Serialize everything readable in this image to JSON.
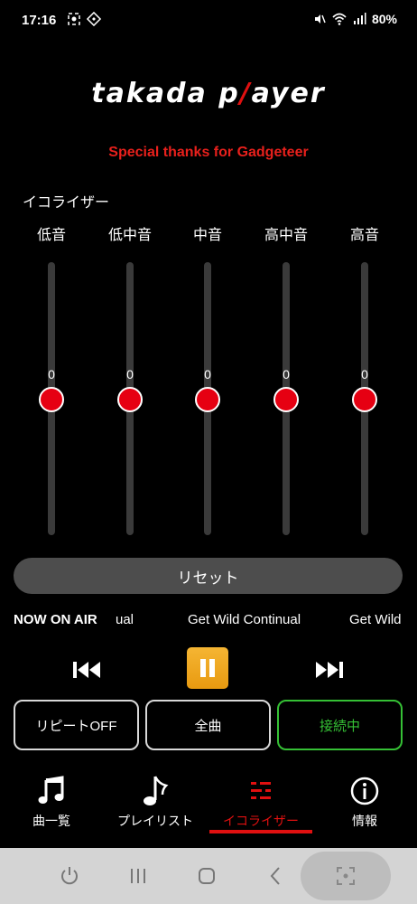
{
  "status": {
    "time": "17:16",
    "battery": "80%"
  },
  "app": {
    "logo_main": "takada p",
    "logo_accent": "/",
    "logo_end": "ayer",
    "thanks": "Special thanks for Gadgeteer"
  },
  "equalizer": {
    "title": "イコライザー",
    "bands": [
      {
        "label": "低音",
        "value": "0"
      },
      {
        "label": "低中音",
        "value": "0"
      },
      {
        "label": "中音",
        "value": "0"
      },
      {
        "label": "高中音",
        "value": "0"
      },
      {
        "label": "高音",
        "value": "0"
      }
    ],
    "reset_label": "リセット"
  },
  "now_playing": {
    "label": "NOW ON AIR",
    "marquee": [
      "ual",
      "Get Wild Continual",
      "Get Wild"
    ]
  },
  "modes": {
    "repeat": "リピートOFF",
    "all": "全曲",
    "connect": "接続中"
  },
  "nav": {
    "items": [
      {
        "label": "曲一覧",
        "icon": "music-notes-icon"
      },
      {
        "label": "プレイリスト",
        "icon": "music-note-icon"
      },
      {
        "label": "イコライザー",
        "icon": "equalizer-icon"
      },
      {
        "label": "情報",
        "icon": "info-icon"
      }
    ],
    "active_index": 2
  },
  "colors": {
    "accent_red": "#e01010",
    "connected_green": "#35c035",
    "pause_orange": "#f0a820"
  }
}
